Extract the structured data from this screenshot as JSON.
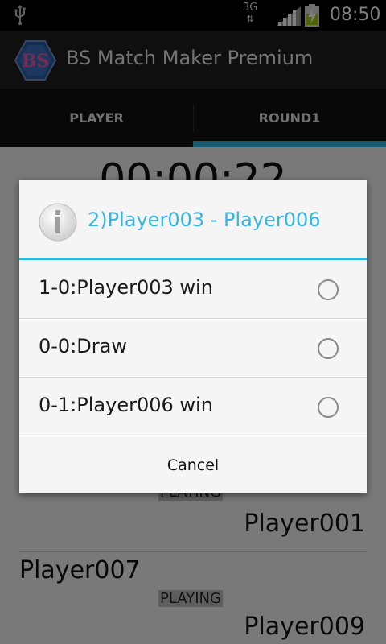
{
  "status_bar": {
    "network": "3G",
    "time": "08:50"
  },
  "app": {
    "logo_text": "BS",
    "title": "BS Match Maker Premium"
  },
  "tabs": [
    {
      "label": "PLAYER",
      "active": false
    },
    {
      "label": "ROUND1",
      "active": true
    }
  ],
  "background": {
    "timer": "00:00:22",
    "matches": [
      {
        "status": "PLAYING",
        "right_player": "Player001"
      },
      {
        "left_player": "Player007",
        "status": "PLAYING",
        "right_player": "Player009"
      }
    ]
  },
  "dialog": {
    "title": "2)Player003 - Player006",
    "options": [
      {
        "label": "1-0:Player003 win",
        "selected": false
      },
      {
        "label": "0-0:Draw",
        "selected": false
      },
      {
        "label": "0-1:Player006 win",
        "selected": false
      }
    ],
    "cancel_label": "Cancel"
  },
  "colors": {
    "accent": "#33b5e5",
    "action_bar": "#1f1f1f",
    "tab_bar": "#111111"
  }
}
